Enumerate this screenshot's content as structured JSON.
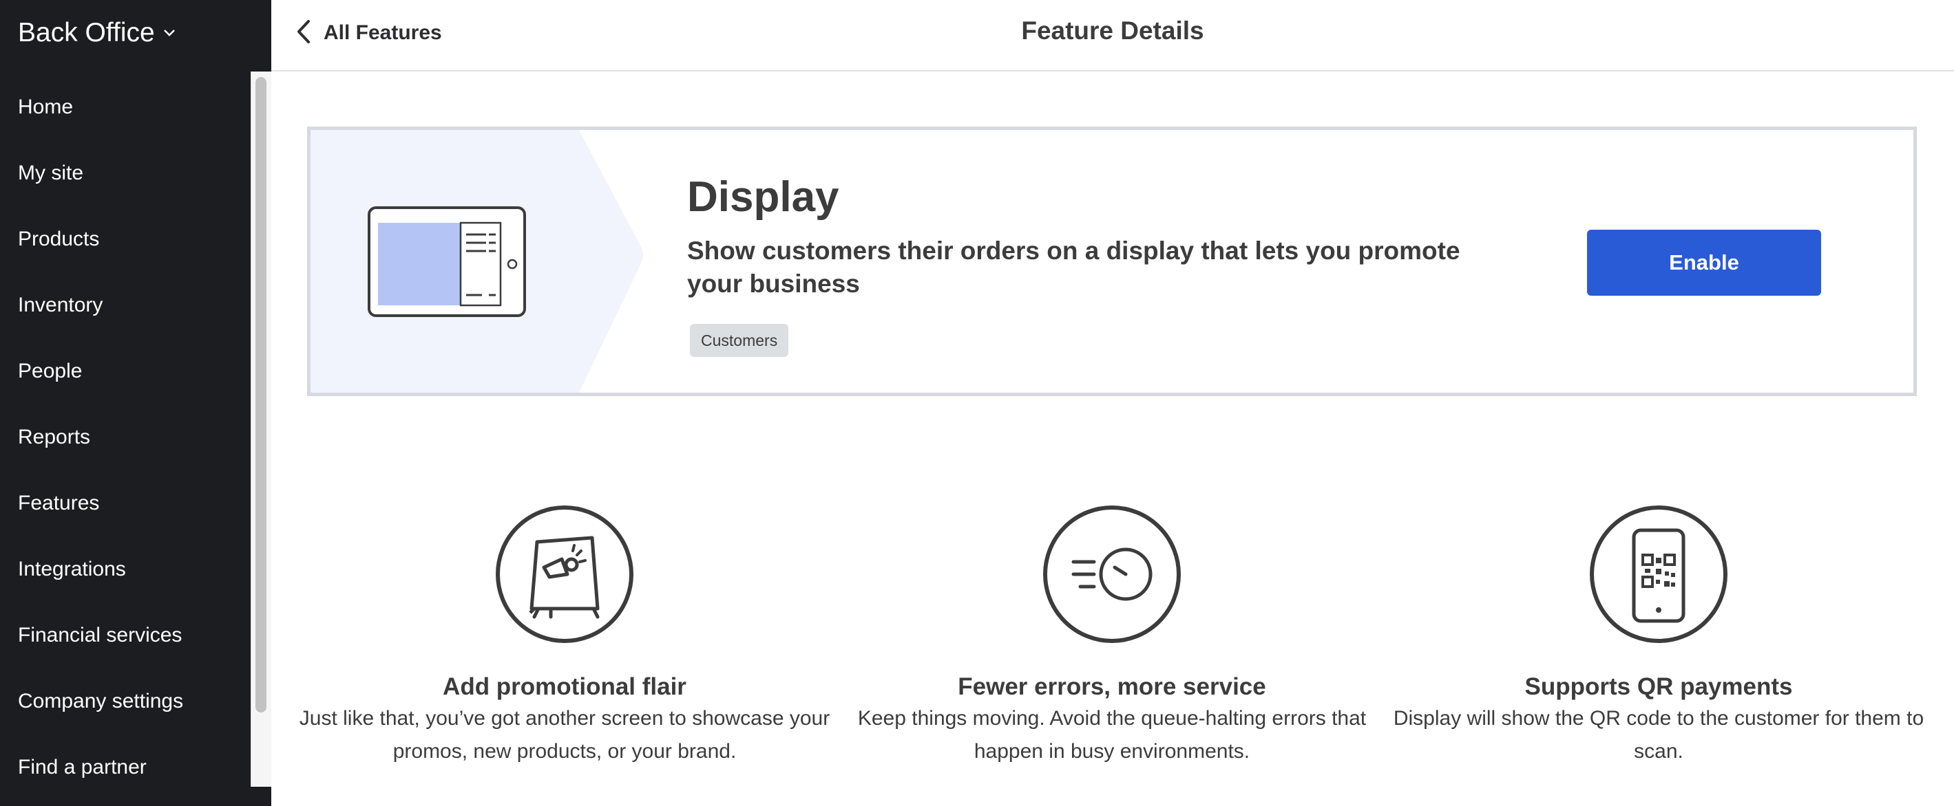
{
  "sidebar": {
    "brand": "Back Office",
    "items": [
      {
        "label": "Home"
      },
      {
        "label": "My site"
      },
      {
        "label": "Products"
      },
      {
        "label": "Inventory"
      },
      {
        "label": "People"
      },
      {
        "label": "Reports"
      },
      {
        "label": "Features"
      },
      {
        "label": "Integrations"
      },
      {
        "label": "Financial services"
      },
      {
        "label": "Company settings"
      },
      {
        "label": "Find a partner"
      }
    ]
  },
  "header": {
    "back_label": "All Features",
    "title": "Feature Details"
  },
  "feature": {
    "title": "Display",
    "description": "Show customers their orders on a display that lets you promote your business",
    "tag": "Customers",
    "enable_label": "Enable"
  },
  "benefits": [
    {
      "icon": "promo-easel-icon",
      "title": "Add promotional flair",
      "description": "Just like that, you’ve got another screen to showcase your promos, new products, or your brand."
    },
    {
      "icon": "fast-clock-icon",
      "title": "Fewer errors, more service",
      "description": "Keep things moving. Avoid the queue-halting errors that happen in busy environments."
    },
    {
      "icon": "phone-qr-icon",
      "title": "Supports QR payments",
      "description": "Display will show the QR code to the customer for them to scan."
    }
  ],
  "colors": {
    "sidebar_bg": "#1c1d21",
    "accent": "#2a5bd7",
    "art_bg": "#f1f4fc",
    "screen_fill": "#b4c4f5"
  }
}
